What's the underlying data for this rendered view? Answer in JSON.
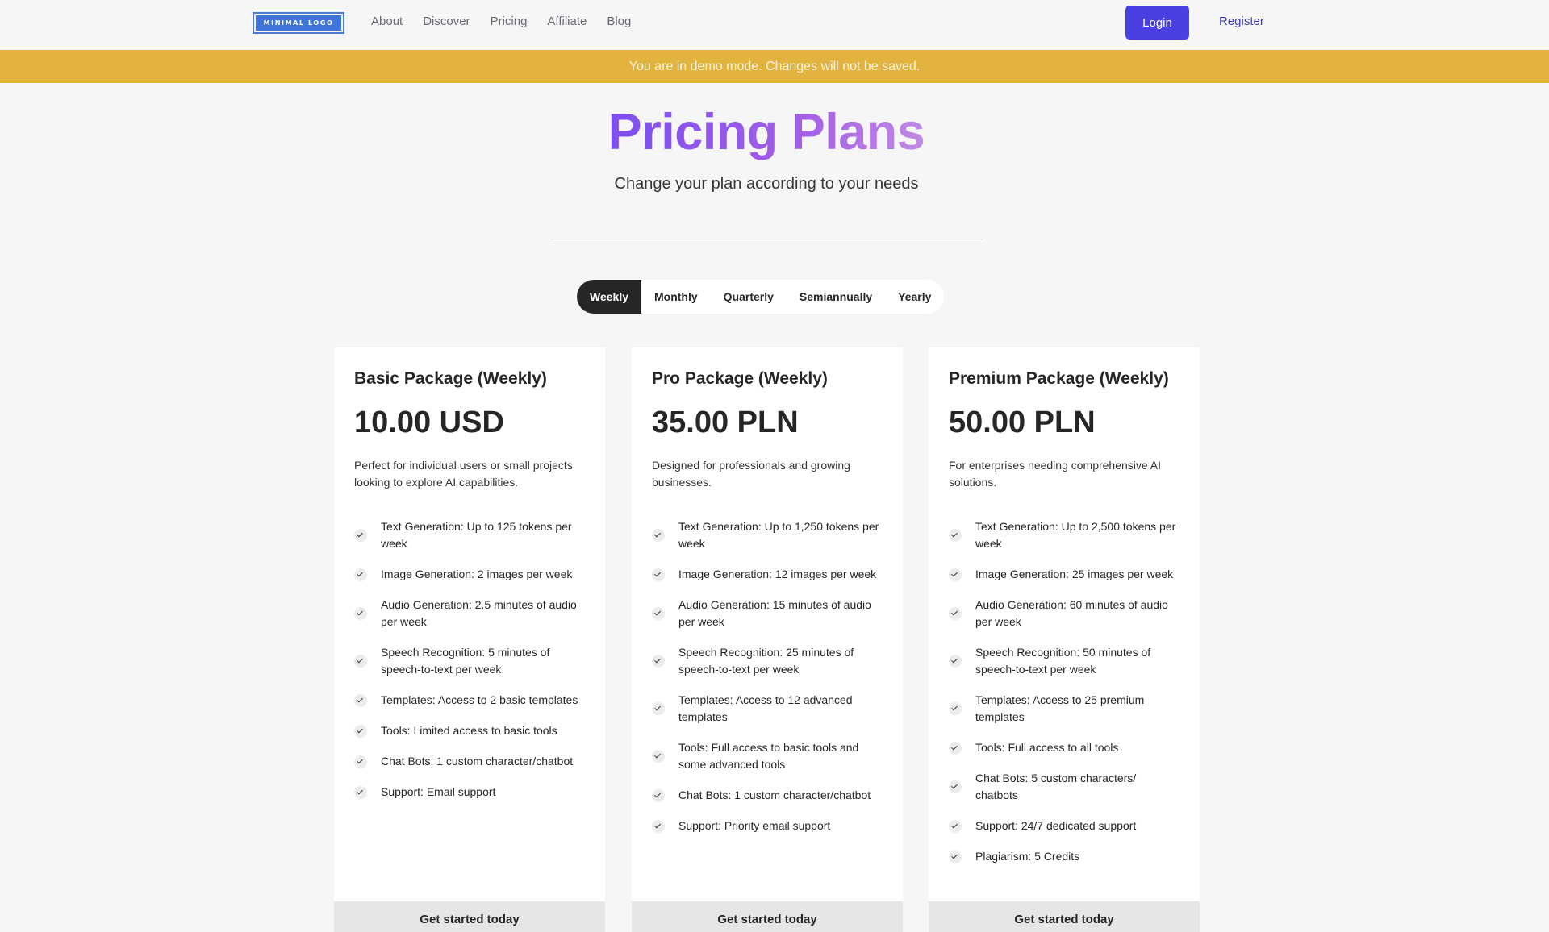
{
  "header": {
    "logo_text": "MINIMAL LOGO",
    "nav": [
      "About",
      "Discover",
      "Pricing",
      "Affiliate",
      "Blog"
    ],
    "login_label": "Login",
    "register_label": "Register"
  },
  "banner": {
    "text": "You are in demo mode. Changes will not be saved."
  },
  "hero": {
    "title": "Pricing Plans",
    "subtitle": "Change your plan according to your needs"
  },
  "periods": {
    "options": [
      "Weekly",
      "Monthly",
      "Quarterly",
      "Semiannually",
      "Yearly"
    ],
    "selected": "Weekly"
  },
  "plans": [
    {
      "name": "Basic Package (Weekly)",
      "price": "10.00 USD",
      "description": "Perfect for individual users or small projects looking to explore AI capabilities.",
      "features": [
        "Text Generation: Up to 125 tokens per week",
        "Image Generation: 2 images per week",
        "Audio Generation: 2.5 minutes of audio per week",
        "Speech Recognition: 5 minutes of speech-to-text per week",
        "Templates: Access to 2 basic templates",
        "Tools: Limited access to basic tools",
        "Chat Bots: 1 custom character/chatbot",
        "Support: Email support"
      ],
      "cta": "Get started today"
    },
    {
      "name": "Pro Package (Weekly)",
      "price": "35.00 PLN",
      "description": "Designed for professionals and growing businesses.",
      "features": [
        "Text Generation: Up to 1,250 tokens per week",
        "Image Generation: 12 images per week",
        "Audio Generation: 15 minutes of audio per week",
        "Speech Recognition: 25 minutes of speech-to-text per week",
        "Templates: Access to 12 advanced templates",
        "Tools: Full access to basic tools and some advanced tools",
        "Chat Bots: 1 custom character/chatbot",
        "Support: Priority email support"
      ],
      "cta": "Get started today"
    },
    {
      "name": "Premium Package (Weekly)",
      "price": "50.00 PLN",
      "description": "For enterprises needing comprehensive AI solutions.",
      "features": [
        "Text Generation: Up to 2,500 tokens per week",
        "Image Generation: 25 images per week",
        "Audio Generation: 60 minutes of audio per week",
        "Speech Recognition: 50 minutes of speech-to-text per week",
        "Templates: Access to 25 premium templates",
        "Tools: Full access to all tools",
        "Chat Bots: 5 custom characters/ chatbots",
        "Support: 24/7 dedicated support",
        "Plagiarism: 5 Credits"
      ],
      "cta": "Get started today"
    }
  ],
  "colors": {
    "accent": "#4a3fe0",
    "banner": "#e2b33f",
    "title_gradient_start": "#7b4ff0",
    "title_gradient_end": "#c08ae6"
  },
  "icons": {
    "feature_check": "check-icon"
  }
}
